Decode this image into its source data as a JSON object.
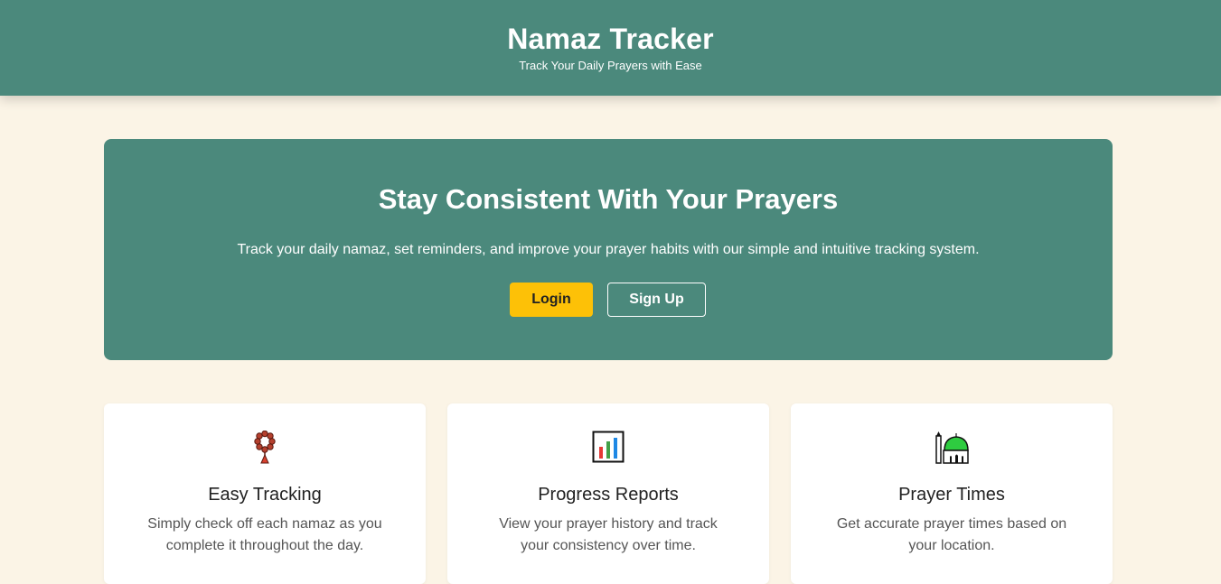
{
  "header": {
    "title": "Namaz Tracker",
    "subtitle": "Track Your Daily Prayers with Ease"
  },
  "hero": {
    "title": "Stay Consistent With Your Prayers",
    "description": "Track your daily namaz, set reminders, and improve your prayer habits with our simple and intuitive tracking system.",
    "login_label": "Login",
    "signup_label": "Sign Up"
  },
  "features": [
    {
      "icon": "prayer-beads-icon",
      "title": "Easy Tracking",
      "description": "Simply check off each namaz as you complete it throughout the day."
    },
    {
      "icon": "bar-chart-icon",
      "title": "Progress Reports",
      "description": "View your prayer history and track your consistency over time."
    },
    {
      "icon": "mosque-icon",
      "title": "Prayer Times",
      "description": "Get accurate prayer times based on your location."
    }
  ],
  "colors": {
    "primary": "#4b897c",
    "accent": "#fdc107",
    "background": "#fbf4e6"
  }
}
